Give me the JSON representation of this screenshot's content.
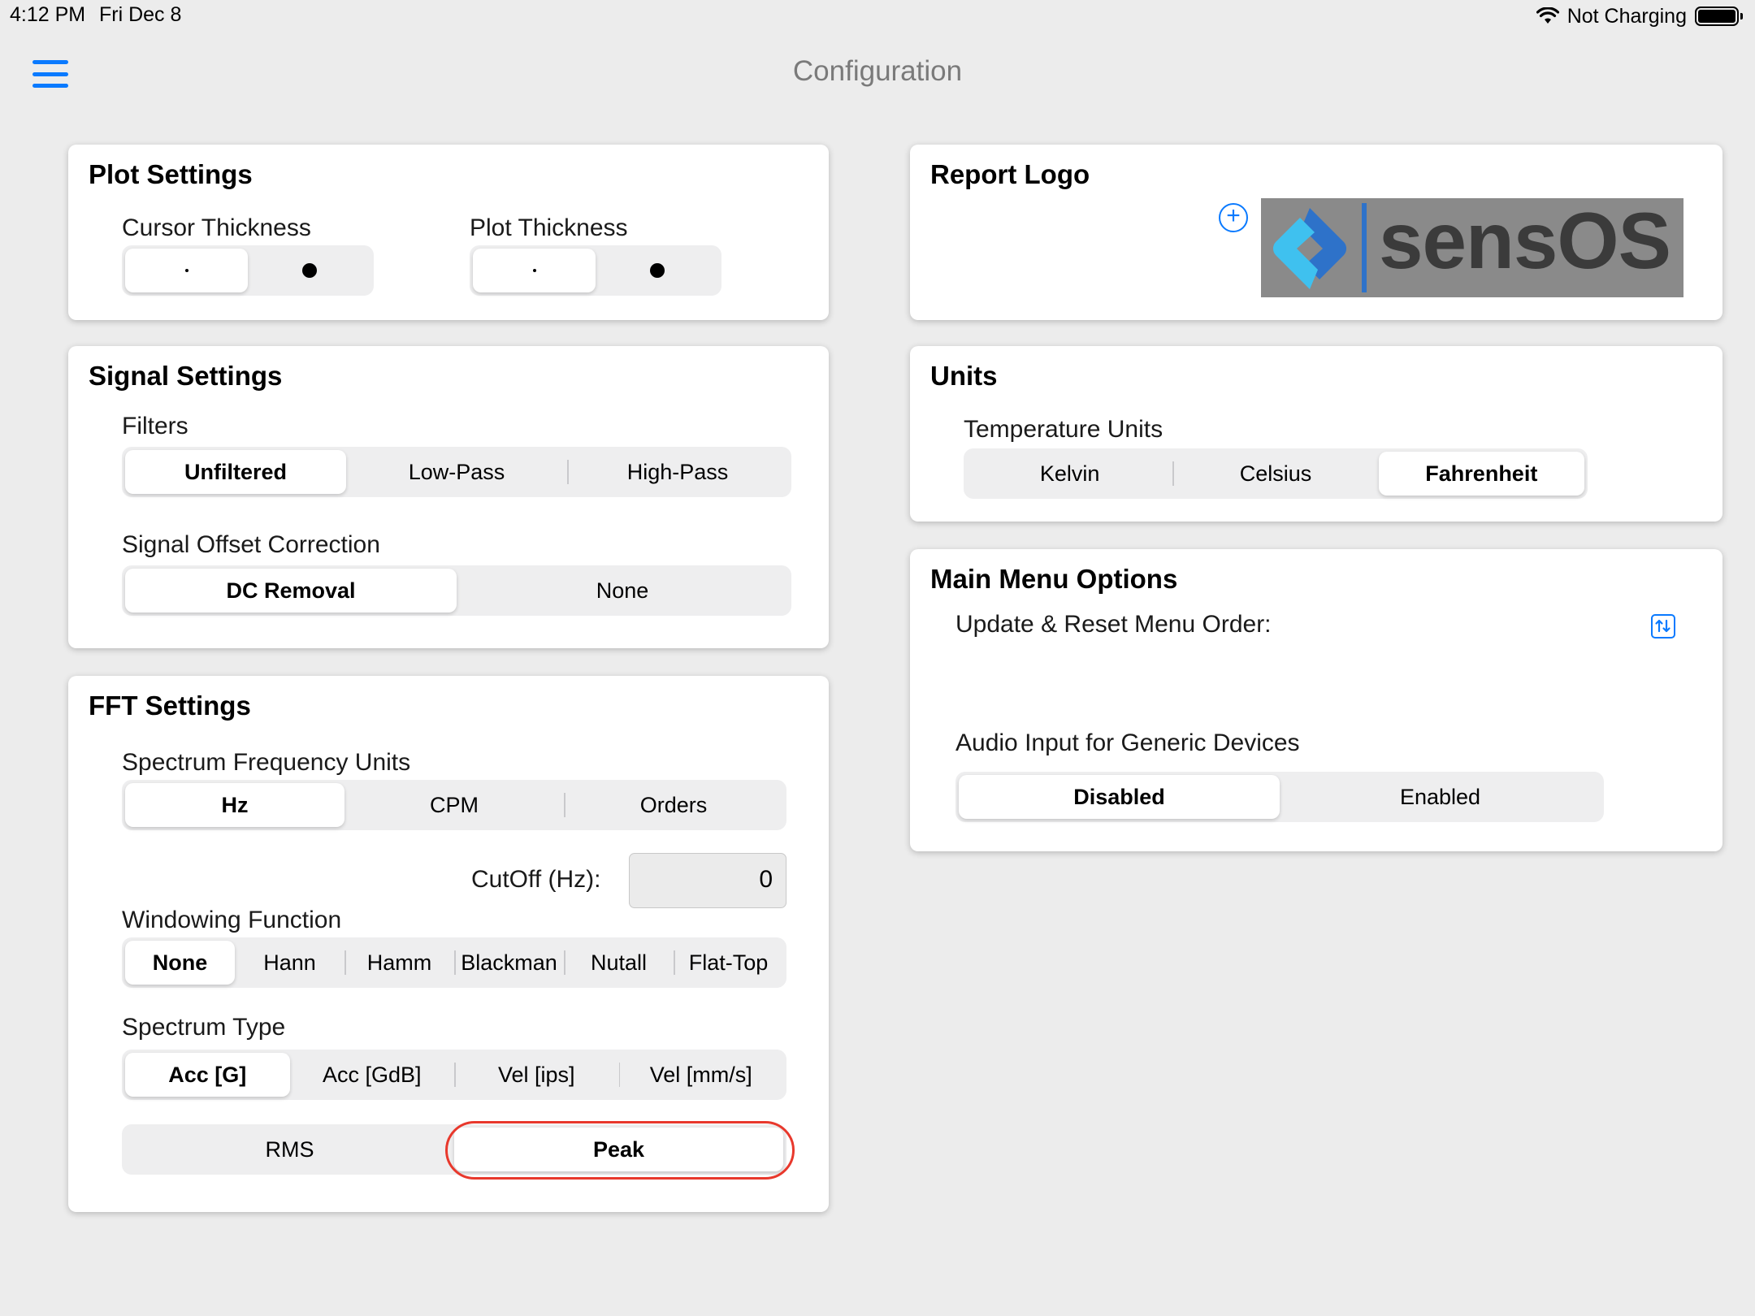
{
  "status_bar": {
    "time": "4:12 PM",
    "date": "Fri Dec 8",
    "battery_status": "Not Charging",
    "battery_level": 1.0
  },
  "nav": {
    "title": "Configuration",
    "menu_icon": "hamburger-menu-icon"
  },
  "plot_settings": {
    "title": "Plot Settings",
    "cursor_thickness": {
      "label": "Cursor Thickness",
      "options": [
        "thin",
        "thick"
      ],
      "selected": "thin"
    },
    "plot_thickness": {
      "label": "Plot Thickness",
      "options": [
        "thin",
        "thick"
      ],
      "selected": "thin"
    }
  },
  "signal_settings": {
    "title": "Signal Settings",
    "filters": {
      "label": "Filters",
      "options": [
        "Unfiltered",
        "Low-Pass",
        "High-Pass"
      ],
      "selected": "Unfiltered"
    },
    "offset": {
      "label": "Signal Offset Correction",
      "options": [
        "DC Removal",
        "None"
      ],
      "selected": "DC Removal"
    }
  },
  "fft_settings": {
    "title": "FFT Settings",
    "freq_units": {
      "label": "Spectrum Frequency Units",
      "options": [
        "Hz",
        "CPM",
        "Orders"
      ],
      "selected": "Hz"
    },
    "cutoff": {
      "label": "CutOff (Hz):",
      "value": "0"
    },
    "windowing": {
      "label": "Windowing Function",
      "options": [
        "None",
        "Hann",
        "Hamm",
        "Blackman",
        "Nutall",
        "Flat-Top"
      ],
      "selected": "None"
    },
    "spectrum_type": {
      "label": "Spectrum Type",
      "options": [
        "Acc [G]",
        "Acc [GdB]",
        "Vel [ips]",
        "Vel [mm/s]"
      ],
      "selected": "Acc [G]"
    },
    "amplitude": {
      "options": [
        "RMS",
        "Peak"
      ],
      "selected": "Peak"
    }
  },
  "report_logo": {
    "title": "Report Logo",
    "add_icon": "plus-circle-icon",
    "logo_text": "sensOS"
  },
  "units": {
    "title": "Units",
    "temperature": {
      "label": "Temperature Units",
      "options": [
        "Kelvin",
        "Celsius",
        "Fahrenheit"
      ],
      "selected": "Fahrenheit"
    }
  },
  "main_menu": {
    "title": "Main Menu Options",
    "reorder_label": "Update & Reset Menu Order:",
    "reorder_icon": "reorder-arrows-icon",
    "audio": {
      "label": "Audio Input for Generic Devices",
      "options": [
        "Disabled",
        "Enabled"
      ],
      "selected": "Disabled"
    }
  },
  "colors": {
    "accent": "#0a7aff",
    "highlight": "#e8382c",
    "background": "#ececec"
  }
}
